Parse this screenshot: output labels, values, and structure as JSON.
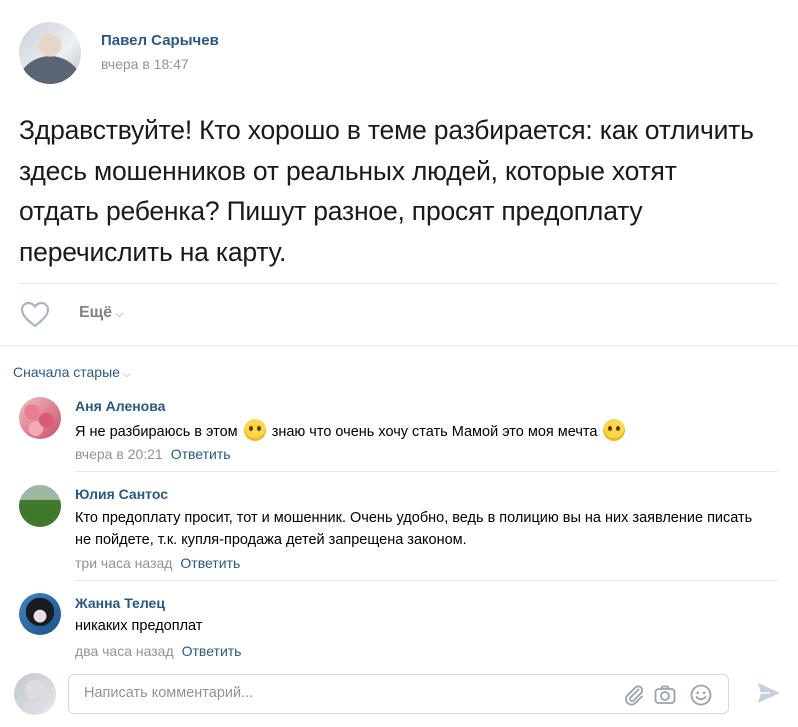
{
  "post": {
    "author": "Павел Сарычев",
    "time": "вчера в 18:47",
    "text": "Здравствуйте! Кто хорошо в теме разбирается: как отличить здесь мошенников от реальных людей, которые хотят отдать ребенка? Пишут разное, просят предоплату перечислить на карту.",
    "more_label": "Ещё"
  },
  "comments_header": {
    "sort_label": "Сначала старые"
  },
  "comments": [
    {
      "author": "Аня Аленова",
      "text_part1": "Я не разбираюсь в этом",
      "text_part2": "знаю что очень хочу стать Мамой это моя мечта",
      "time": "вчера в 20:21",
      "reply_label": "Ответить"
    },
    {
      "author": "Юлия Сантос",
      "text": "Кто предоплату просит, тот и мошенник. Очень удобно, ведь в полицию вы на них заявление писать не пойдете, т.к. купля-продажа детей запрещена законом.",
      "time": "три часа назад",
      "reply_label": "Ответить"
    },
    {
      "author": "Жанна Телец",
      "text": "никаких предоплат",
      "time": "два часа назад",
      "reply_label": "Ответить"
    }
  ],
  "composer": {
    "placeholder": "Написать комментарий..."
  },
  "icons": {
    "like": "heart-icon",
    "attach": "paperclip-icon",
    "camera": "camera-icon",
    "emoji": "smile-icon",
    "send": "send-icon"
  },
  "colors": {
    "link": "#2a5885",
    "muted": "#939393",
    "divider": "#e7e8ec"
  }
}
